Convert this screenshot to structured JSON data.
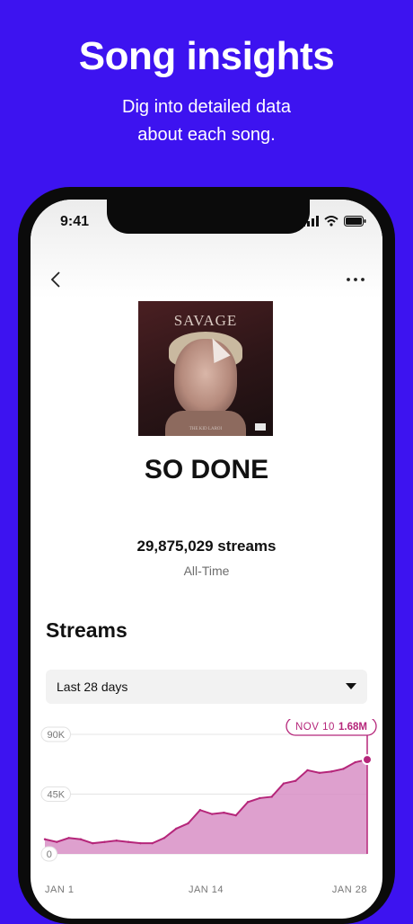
{
  "promo": {
    "headline": "Song insights",
    "subtitle_line1": "Dig into detailed data",
    "subtitle_line2": "about each song."
  },
  "status_bar": {
    "time": "9:41"
  },
  "song": {
    "title": "SO DONE",
    "streams": "29,875,029 streams",
    "period": "All-Time",
    "artwork": {
      "title": "SAVAGE",
      "artist": "THE KID LAROI"
    }
  },
  "section": {
    "title": "Streams",
    "range_select": {
      "value": "Last 28 days"
    }
  },
  "colors": {
    "background": "#3d13f0",
    "accent": "#b5267a",
    "fill": "#d88fc6"
  },
  "chart_data": {
    "type": "area",
    "x": [
      1,
      2,
      3,
      4,
      5,
      6,
      7,
      8,
      9,
      10,
      11,
      12,
      13,
      14,
      15,
      16,
      17,
      18,
      19,
      20,
      21,
      22,
      23,
      24,
      25,
      26,
      27,
      28
    ],
    "y_values": [
      11000,
      9000,
      12000,
      11000,
      8000,
      9000,
      10000,
      9000,
      8000,
      8000,
      12000,
      19000,
      23000,
      33000,
      30000,
      31000,
      29000,
      39000,
      42000,
      43000,
      53000,
      55000,
      63000,
      61000,
      62000,
      64000,
      69000,
      71000
    ],
    "x_tick_labels": [
      "JAN 1",
      "JAN 14",
      "JAN 28"
    ],
    "y_tick_labels": [
      "90K",
      "45K",
      "0"
    ],
    "ylim": [
      0,
      90000
    ],
    "tooltip": {
      "date": "NOV 10",
      "value": "1.68M"
    },
    "grid": true
  }
}
